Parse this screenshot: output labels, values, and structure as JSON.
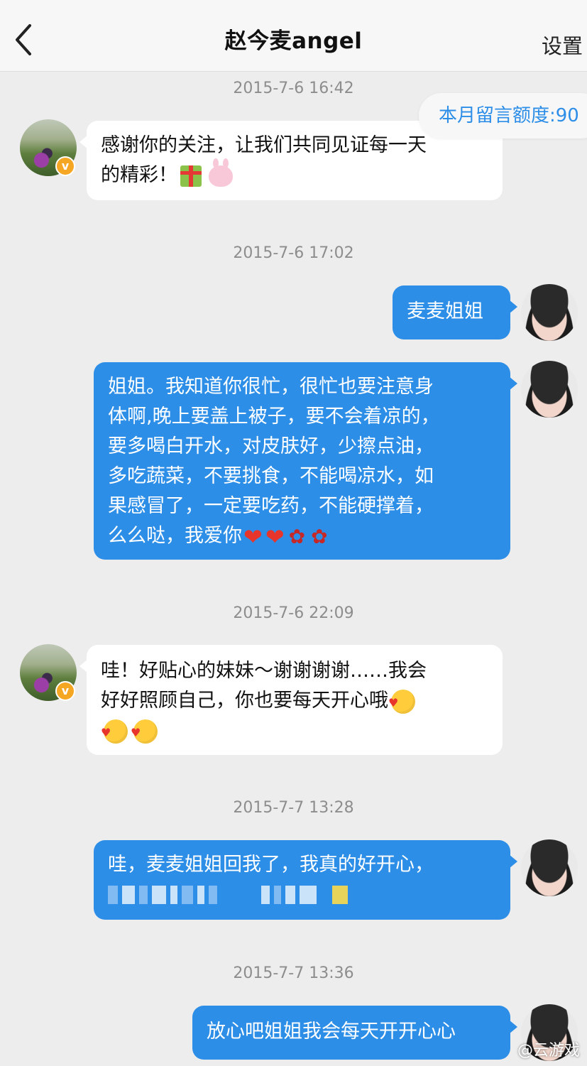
{
  "header": {
    "back_label": "<",
    "title": "赵今麦angel",
    "settings_label": "设置"
  },
  "quota_text": "本月留言额度:90",
  "messages": [
    {
      "timestamp": "2015-7-6 16:42",
      "side": "left",
      "lines": [
        "感谢你的关注，让我们共同见证每一天",
        "的精彩！"
      ]
    },
    {
      "timestamp": "2015-7-6 17:02",
      "side": "right",
      "lines": [
        "麦麦姐姐"
      ]
    },
    {
      "side": "right",
      "lines": [
        "姐姐。我知道你很忙，很忙也要注意身",
        "体啊,晚上要盖上被子，要不会着凉的，",
        "要多喝白开水，对皮肤好，少擦点油，",
        "多吃蔬菜，不要挑食，不能喝凉水，如",
        "果感冒了，一定要吃药，不能硬撑着，",
        "么么哒，我爱你"
      ]
    },
    {
      "timestamp": "2015-7-6 22:09",
      "side": "left",
      "lines": [
        "哇！好贴心的妹妹～谢谢谢谢……我会",
        "好好照顾自己，你也要每天开心哦"
      ]
    },
    {
      "timestamp": "2015-7-7 13:28",
      "side": "right",
      "lines": [
        "哇，麦麦姐姐回我了，我真的好开心，"
      ]
    },
    {
      "timestamp": "2015-7-7 13:36",
      "side": "right",
      "lines": [
        "放心吧姐姐我会每天开开心心"
      ]
    }
  ],
  "badge_label": "v",
  "watermark": "@云游戏",
  "colors": {
    "bubble_right": "#2d8ee8",
    "bubble_left": "#ffffff",
    "background": "#ededed",
    "quota_text": "#2d8ee8"
  }
}
